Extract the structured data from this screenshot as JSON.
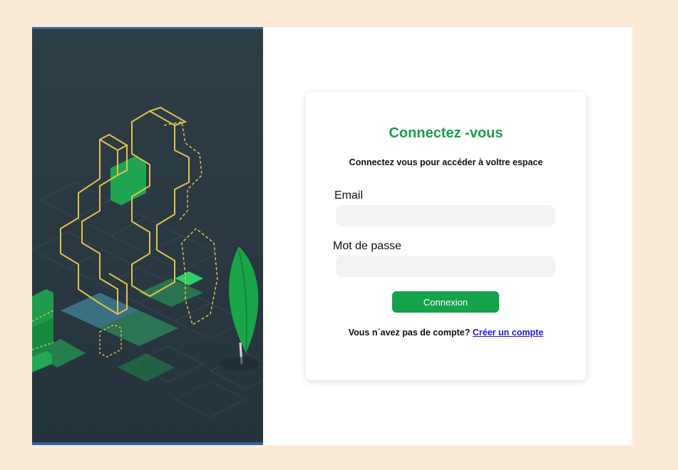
{
  "illustration": {
    "icon": "code-braces-leaf-illustration",
    "colors": {
      "background": "#2b3942",
      "outline": "#e2c24a",
      "leaf": "#19a548",
      "border": "#2f66a8"
    }
  },
  "login": {
    "title": "Connectez -vous",
    "subtitle": "Connectez vous pour accéder à voltre espace",
    "email_label": "Email",
    "email_value": "",
    "email_placeholder": "",
    "password_label": "Mot de passe",
    "password_value": "",
    "password_placeholder": "",
    "submit_label": "Connexion",
    "signup_prompt": "Vous n´avez pas de compte?",
    "signup_link": "Créer un compte"
  },
  "colors": {
    "page_background": "#fbebd6",
    "accent": "#14a24b",
    "link": "#1a1adf"
  }
}
